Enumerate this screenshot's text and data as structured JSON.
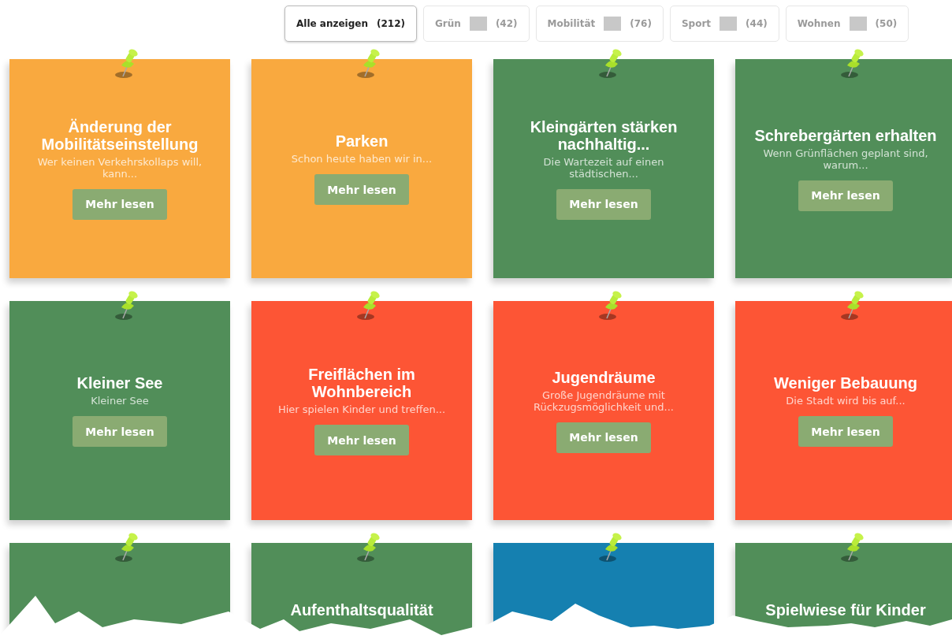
{
  "filters": [
    {
      "kind": "all",
      "label": "Alle anzeigen",
      "count": "(212)",
      "selected": true
    },
    {
      "kind": "category",
      "label": "Grün",
      "count": "(42)",
      "selected": false
    },
    {
      "kind": "category",
      "label": "Mobilität",
      "count": "(76)",
      "selected": false
    },
    {
      "kind": "category",
      "label": "Sport",
      "count": "(44)",
      "selected": false
    },
    {
      "kind": "category",
      "label": "Wohnen",
      "count": "(50)",
      "selected": false
    }
  ],
  "cards": [
    {
      "color": "#f9a93f",
      "title": "Änderung der Mobilitätseinstellung",
      "text": "Wer keinen Verkehrskollaps will, kann...",
      "button": "Mehr lesen"
    },
    {
      "color": "#f9a93f",
      "title": "Parken",
      "text": "Schon heute haben wir in...",
      "button": "Mehr lesen"
    },
    {
      "color": "#518e59",
      "title": "Kleingärten stärken nachhaltig...",
      "text": "Die Wartezeit auf einen städtischen...",
      "button": "Mehr lesen"
    },
    {
      "color": "#518e59",
      "title": "Schrebergärten erhalten",
      "text": "Wenn Grünflächen geplant sind, warum...",
      "button": "Mehr lesen"
    },
    {
      "color": "#518e59",
      "title": "Kleiner See",
      "text": "Kleiner See",
      "button": "Mehr lesen"
    },
    {
      "color": "#fd5535",
      "title": "Freiflächen im Wohnbereich",
      "text": "Hier spielen Kinder und treffen...",
      "button": "Mehr lesen"
    },
    {
      "color": "#fd5535",
      "title": "Jugendräume",
      "text": "Große Jugendräume mit Rückzugsmöglichkeit und...",
      "button": "Mehr lesen"
    },
    {
      "color": "#fd5535",
      "title": "Weniger Bebauung",
      "text": "Die Stadt wird bis auf...",
      "button": "Mehr lesen"
    },
    {
      "color": "#518e59"
    },
    {
      "color": "#518e59",
      "title": "Aufenthaltsqualität"
    },
    {
      "color": "#1580b0"
    },
    {
      "color": "#518e59",
      "title": "Spielwiese für Kinder"
    }
  ]
}
